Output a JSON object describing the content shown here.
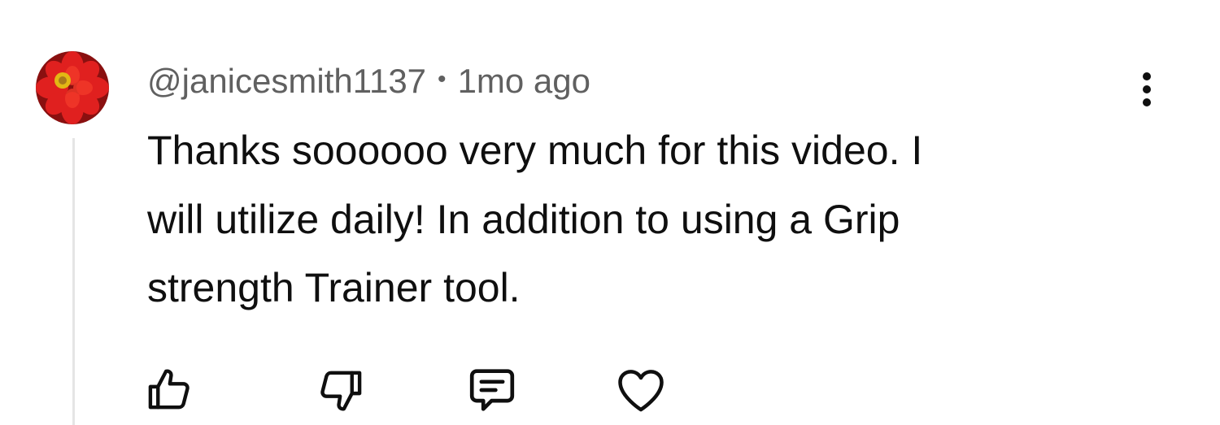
{
  "comment": {
    "author": "@janicesmith1137",
    "separator": "•",
    "timestamp": "1mo ago",
    "text": "Thanks soooooo very much for this video.  I\nwill utilize daily! In addition to using a Grip\nstrength Trainer tool.",
    "avatar_icon": "red-flower-avatar",
    "menu_icon": "more-vertical-icon"
  },
  "actions": {
    "like_icon": "thumbs-up-icon",
    "dislike_icon": "thumbs-down-icon",
    "reply_icon": "comment-reply-icon",
    "heart_icon": "heart-icon"
  },
  "colors": {
    "text_primary": "#0f0f0f",
    "text_secondary": "#606060",
    "thread_line": "#e5e5e5",
    "avatar_red": "#d81e1e"
  }
}
